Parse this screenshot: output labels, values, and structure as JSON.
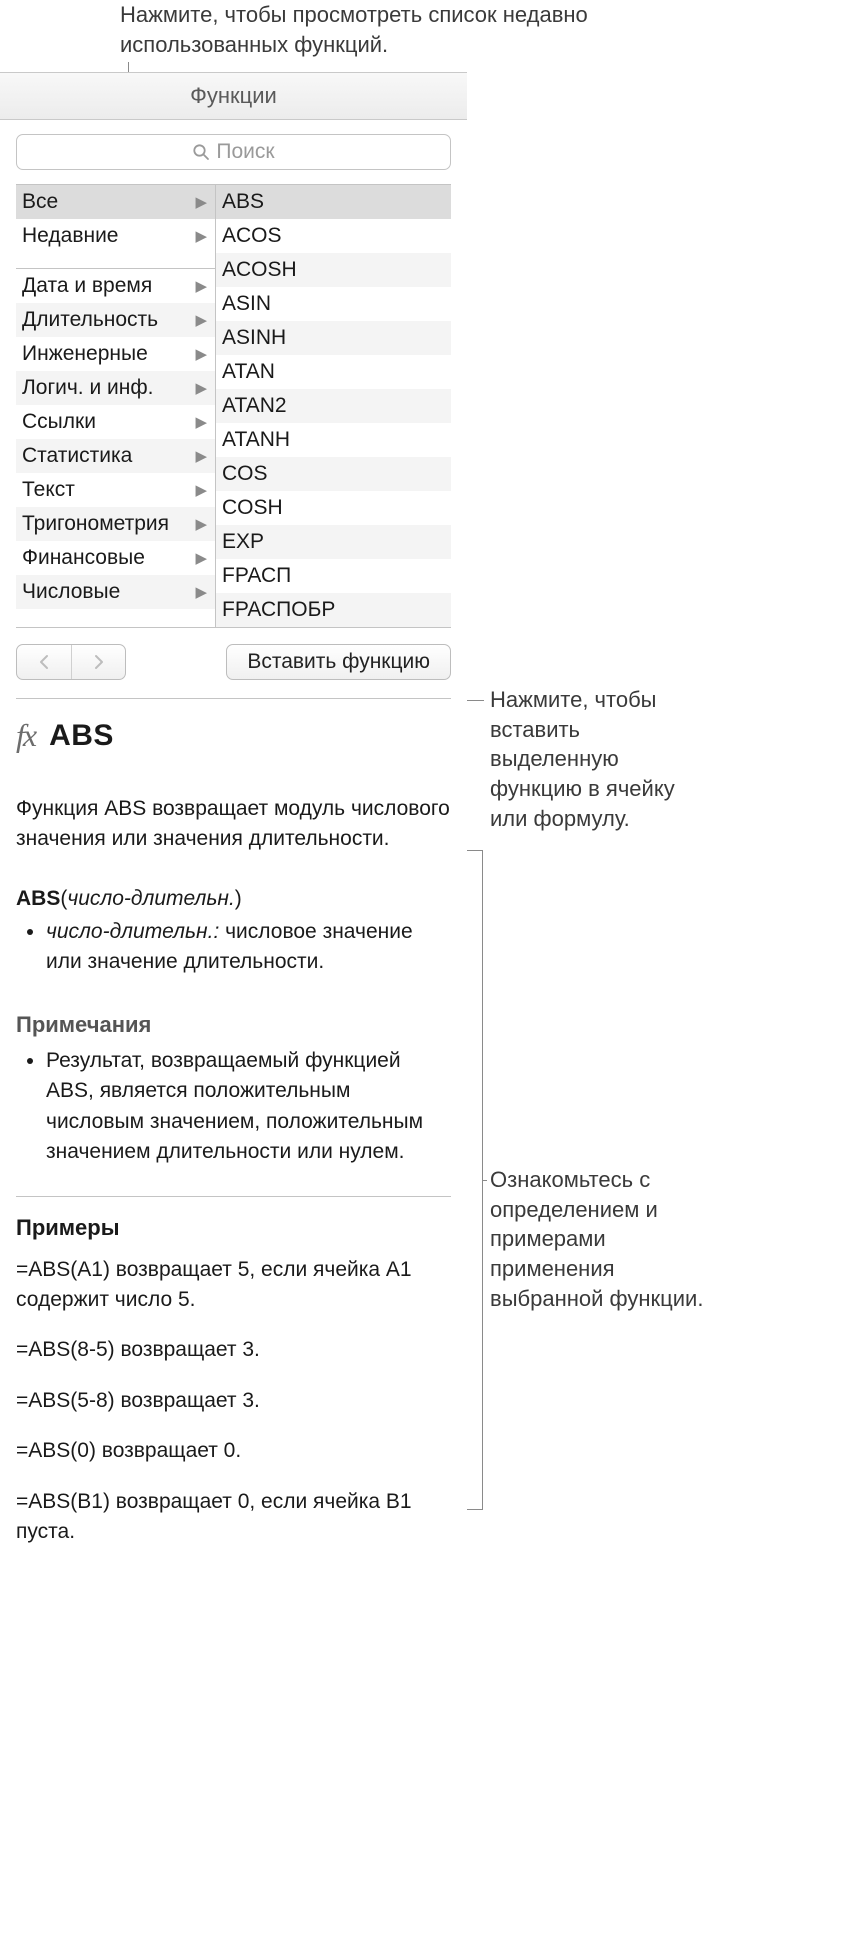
{
  "callouts": {
    "top": "Нажмите, чтобы просмотреть список недавно использованных функций.",
    "right1": "Нажмите, чтобы вставить выделенную функцию в ячейку или формулу.",
    "right2": "Ознакомьтесь с определением и примерами применения выбранной функции."
  },
  "panel": {
    "title": "Функции",
    "search_placeholder": "Поиск",
    "categories": [
      {
        "label": "Все",
        "selected": true
      },
      {
        "label": "Недавние"
      },
      {
        "separator": true
      },
      {
        "label": "Дата и время"
      },
      {
        "label": "Длительность"
      },
      {
        "label": "Инженерные"
      },
      {
        "label": "Логич. и инф."
      },
      {
        "label": "Ссылки"
      },
      {
        "label": "Статистика"
      },
      {
        "label": "Текст"
      },
      {
        "label": "Тригонометрия"
      },
      {
        "label": "Финансовые"
      },
      {
        "label": "Числовые"
      }
    ],
    "functions": [
      "ABS",
      "ACOS",
      "ACOSH",
      "ASIN",
      "ASINH",
      "ATAN",
      "ATAN2",
      "ATANH",
      "COS",
      "COSH",
      "EXP",
      "FРАСП",
      "FРАСПОБР"
    ],
    "insert_label": "Вставить функцию"
  },
  "detail": {
    "fx_symbol": "fx",
    "name": "ABS",
    "description": "Функция ABS возвращает модуль числового значения или значения длительности.",
    "syntax_fn": "ABS",
    "syntax_arg": "число-длительн.",
    "arg_name": "число-длительн.:",
    "arg_desc": " числовое значение или значение длительности.",
    "notes_heading": "Примечания",
    "notes": [
      "Результат, возвращаемый функцией ABS, является положительным числовым значением, положительным значением длительности или нулем."
    ],
    "examples_heading": "Примеры",
    "examples": [
      "=ABS(A1) возвращает 5, если ячейка A1 содержит число 5.",
      "=ABS(8-5) возвращает 3.",
      "=ABS(5-8) возвращает 3.",
      "=ABS(0) возвращает 0.",
      "=ABS(B1) возвращает 0, если ячейка B1 пуста."
    ]
  }
}
